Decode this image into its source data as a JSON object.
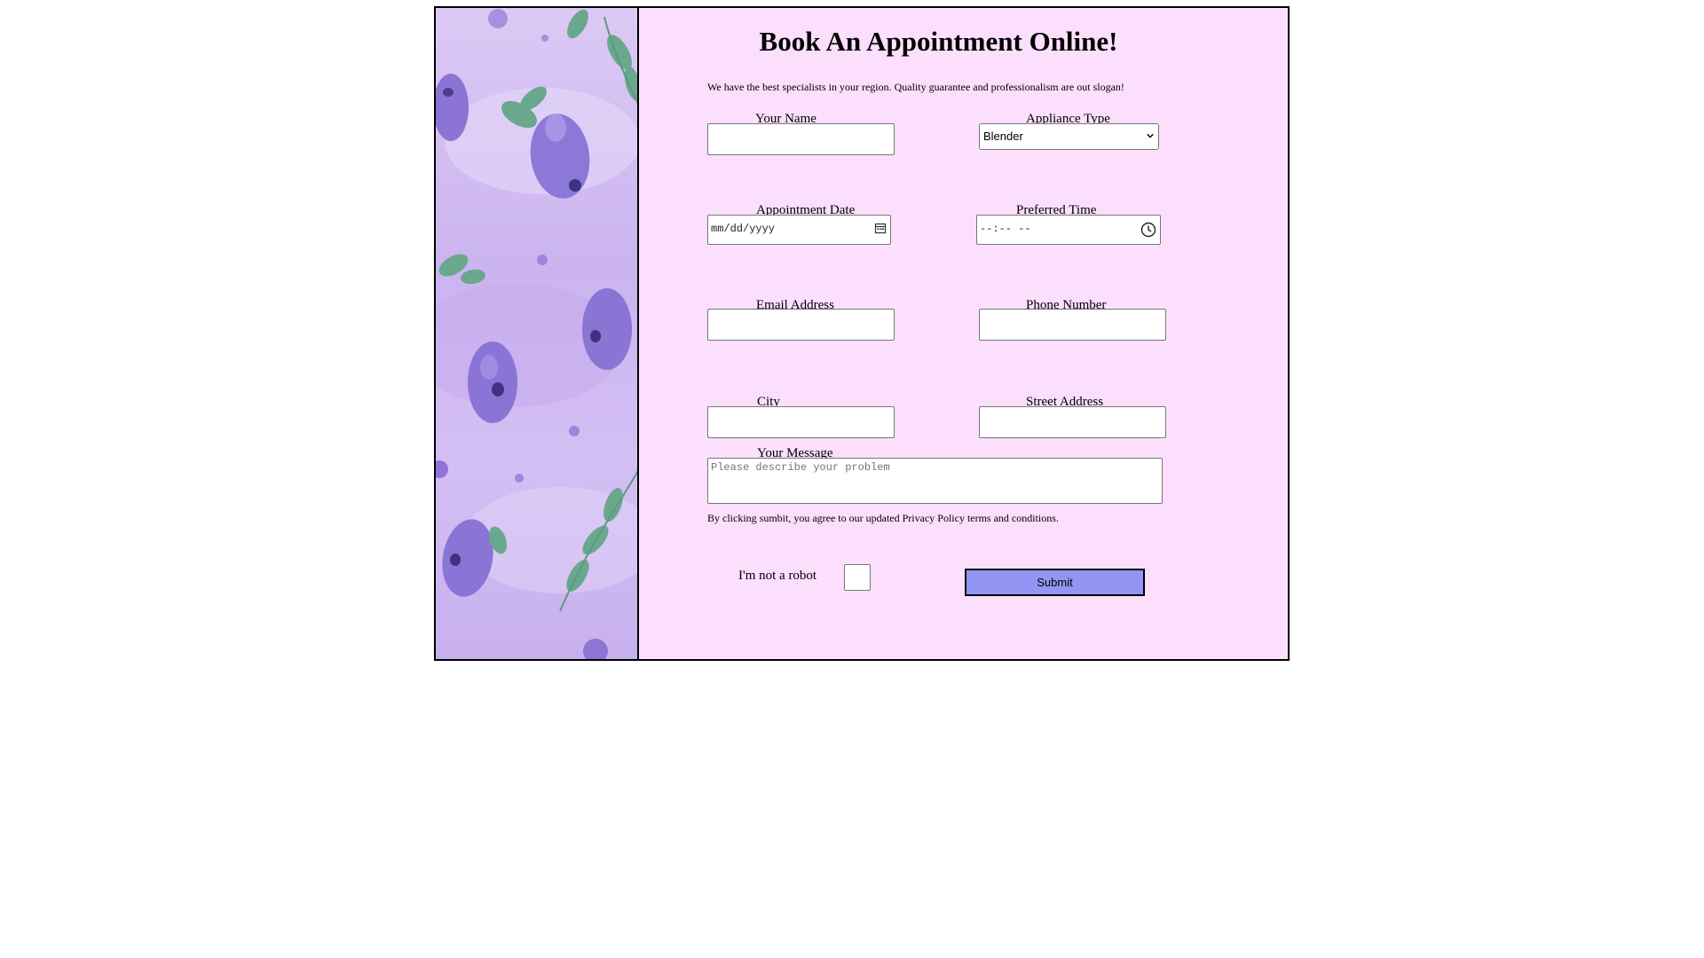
{
  "heading": "Book An Appointment Online!",
  "slogan": "We have the best specialists in your region. Quality guarantee and professionalism are out slogan!",
  "fields": {
    "name_label": "Your Name",
    "appliance_label": "Appliance Type",
    "appliance_selected": "Blender",
    "date_label": "Appointment Date",
    "date_placeholder": "mm/dd/yyyy",
    "time_label": "Preferred Time",
    "time_placeholder": "--:-- --",
    "email_label": "Email Address",
    "phone_label": "Phone Number",
    "city_label": "City",
    "street_label": "Street Address",
    "message_label": "Your Message",
    "message_placeholder": "Please describe your problem"
  },
  "terms": "By clicking sumbit, you agree to our updated Privacy Policy terms and conditions.",
  "robot_label": "I'm not a robot",
  "submit_label": "Submit",
  "colors": {
    "panel_bg": "#fcdffd",
    "submit_bg": "#9494f4",
    "side_accent": "#8f7ad6"
  },
  "icons": {
    "date": "calendar-icon",
    "time": "clock-icon",
    "select": "chevron-down-icon"
  }
}
